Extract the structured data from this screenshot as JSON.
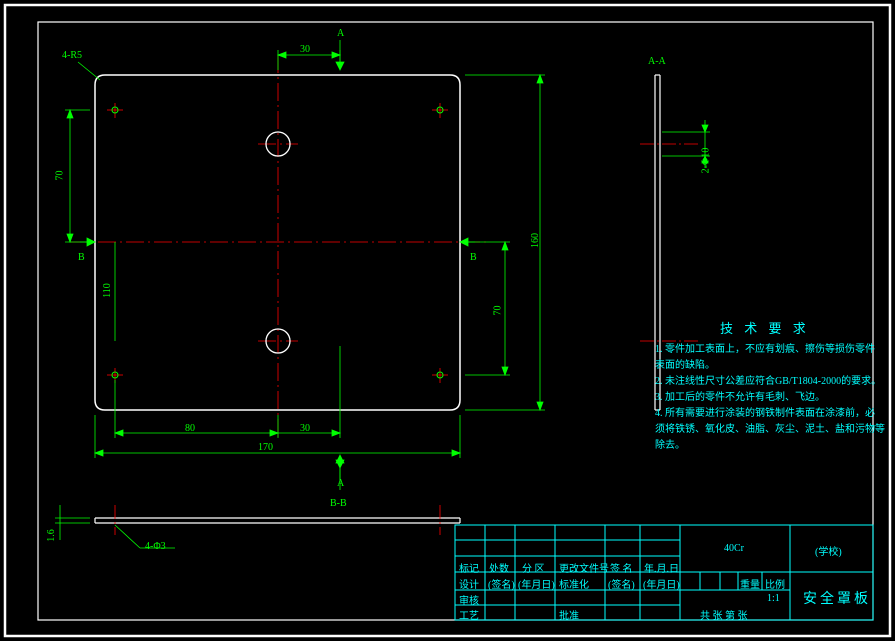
{
  "dimensions": {
    "width_total": "170",
    "dim_80": "80",
    "dim_30_top": "30",
    "dim_30_right": "30",
    "height_160": "160",
    "dim_70_top": "70",
    "dim_70_bottom": "70",
    "dim_110": "110",
    "corner_radius": "4-R5",
    "thickness": "1.6",
    "hole_small": "4-Φ3",
    "hole_pair": "2-Φ10",
    "section_a": "A",
    "section_a_label": "A-A",
    "section_b": "B",
    "section_b_label": "B-B"
  },
  "requirements": {
    "title": "技 术 要 求",
    "lines": [
      "1. 零件加工表面上，不应有划痕、擦伤等损伤零件",
      "   表面的缺陷。",
      "2. 未注线性尺寸公差应符合GB/T1804-2000的要求。",
      "3. 加工后的零件不允许有毛刺、飞边。",
      "4. 所有需要进行涂装的钢铁制件表面在涂漆前，必",
      "   须将铁锈、氧化皮、油脂、灰尘、泥土、盐和污物等",
      "   除去。"
    ]
  },
  "titleblock": {
    "headers": [
      "标记",
      "处数",
      "分 区",
      "更改文件号",
      "签 名",
      "年.月.日"
    ],
    "rows": [
      [
        "设计",
        "(签名)",
        "(年月日)",
        "标准化",
        "(签名)",
        "(年月日)"
      ],
      [
        "审核",
        "",
        "",
        "",
        "",
        ""
      ],
      [
        "工艺",
        "",
        "",
        "批准",
        "",
        ""
      ]
    ],
    "material": "40Cr",
    "stage": "共 张  第 张",
    "scale_label": "比例",
    "scale": "1:1",
    "mass_label": "重量",
    "school": "(学校)",
    "part_name": "安全罩板"
  }
}
